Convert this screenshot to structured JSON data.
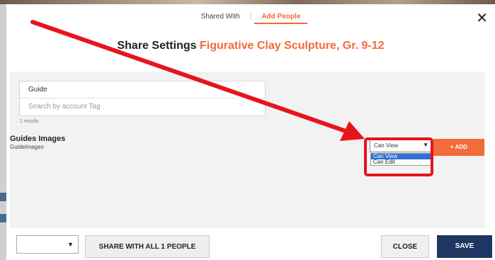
{
  "modal": {
    "tabs": [
      {
        "label": "Shared With",
        "active": false
      },
      {
        "label": "Add People",
        "active": true
      }
    ],
    "close_icon": "close-icon",
    "title_label": "Share Settings",
    "title_name": "Figurative Clay Sculpture, Gr. 9-12"
  },
  "search": {
    "query_value": "Guide",
    "tag_placeholder": "Search by account Tag",
    "results_text": "1 results"
  },
  "result": {
    "name": "Guides Images",
    "username": "GuideImages",
    "permission_selected": "Can View",
    "permission_options": [
      "Can View",
      "Can Edit"
    ],
    "add_label": "+ ADD"
  },
  "footer": {
    "share_all_label": "SHARE WITH ALL 1 PEOPLE",
    "close_label": "CLOSE",
    "save_label": "SAVE"
  },
  "colors": {
    "accent": "#f26b3a",
    "save": "#1f3564",
    "annotation": "#e8141c",
    "selected_option": "#2f6fd6"
  }
}
